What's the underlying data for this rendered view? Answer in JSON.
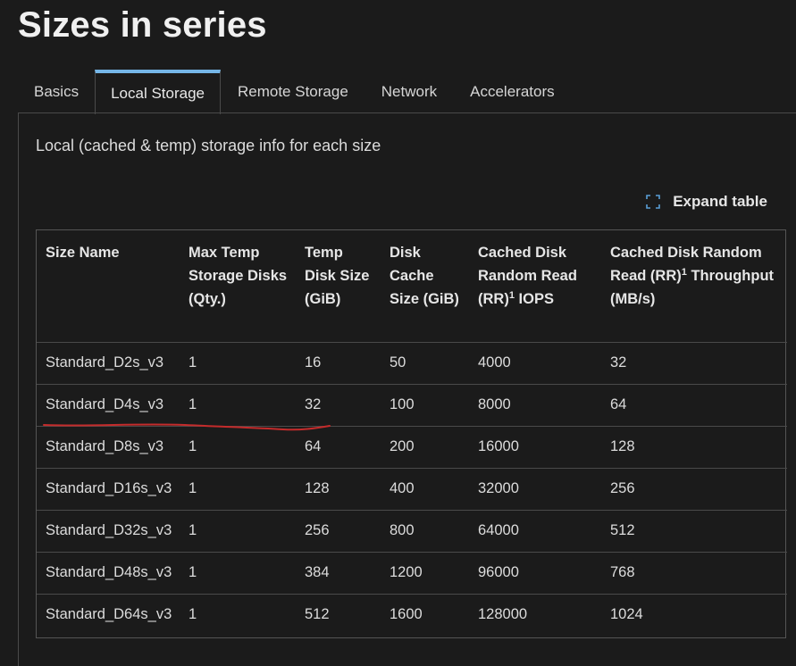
{
  "page": {
    "title": "Sizes in series"
  },
  "tabs": [
    {
      "label": "Basics"
    },
    {
      "label": "Local Storage"
    },
    {
      "label": "Remote Storage"
    },
    {
      "label": "Network"
    },
    {
      "label": "Accelerators"
    }
  ],
  "active_tab": "Local Storage",
  "panel": {
    "description": "Local (cached & temp) storage info for each size"
  },
  "expand_table": {
    "label": "Expand table",
    "icon": "expand-icon"
  },
  "table": {
    "headers": [
      {
        "text": "Size Name"
      },
      {
        "text": "Max Temp Storage Disks (Qty.)"
      },
      {
        "text": "Temp Disk Size (GiB)"
      },
      {
        "text": "Disk Cache Size (GiB)"
      },
      {
        "pre": "Cached Disk Random Read (RR)",
        "sup": "1",
        "post": " IOPS"
      },
      {
        "pre": "Cached Disk Random Read (RR)",
        "sup": "1",
        "post": " Throughput (MB/s)"
      }
    ],
    "rows": [
      [
        "Standard_D2s_v3",
        "1",
        "16",
        "50",
        "4000",
        "32"
      ],
      [
        "Standard_D4s_v3",
        "1",
        "32",
        "100",
        "8000",
        "64"
      ],
      [
        "Standard_D8s_v3",
        "1",
        "64",
        "200",
        "16000",
        "128"
      ],
      [
        "Standard_D16s_v3",
        "1",
        "128",
        "400",
        "32000",
        "256"
      ],
      [
        "Standard_D32s_v3",
        "1",
        "256",
        "800",
        "64000",
        "512"
      ],
      [
        "Standard_D48s_v3",
        "1",
        "384",
        "1200",
        "96000",
        "768"
      ],
      [
        "Standard_D64s_v3",
        "1",
        "512",
        "1600",
        "128000",
        "1024"
      ]
    ]
  },
  "colors": {
    "background": "#1b1b1b",
    "active_tab_accent": "#75b6e7",
    "icon_accent": "#5aa0d8",
    "annotation_underline": "#c42b2b"
  }
}
